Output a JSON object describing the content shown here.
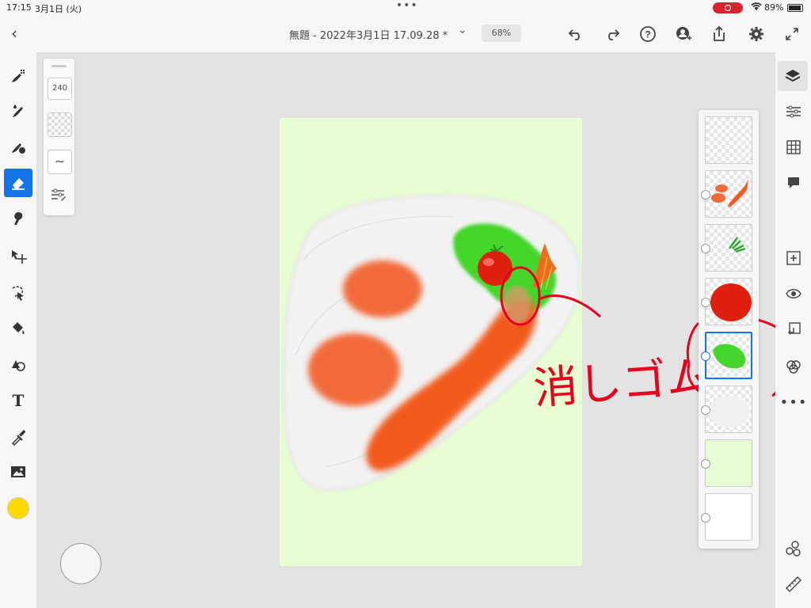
{
  "status_bar": {
    "time": "17:15",
    "date": "3月1日 (火)",
    "battery": "89%",
    "icons": [
      "screen-record-icon",
      "wifi-icon",
      "battery-icon"
    ]
  },
  "header": {
    "document_title": "無題 - 2022年3月1日 17.09.28 *",
    "zoom": "68%",
    "icons": [
      "back-icon",
      "undo-icon",
      "redo-icon",
      "help-icon",
      "invite-icon",
      "share-icon",
      "settings-icon",
      "fullscreen-icon"
    ]
  },
  "brush_panel": {
    "size": "240"
  },
  "left_tools": [
    "pixel-brush",
    "live-brush",
    "vector-brush",
    "eraser",
    "smudge",
    "transform",
    "selection",
    "fill",
    "shapes",
    "text",
    "eyedropper",
    "image"
  ],
  "active_tool": "eraser",
  "current_color": "#ffd800",
  "right_tools": [
    "layers",
    "layer-properties",
    "grid",
    "comments",
    "add-layer",
    "visibility",
    "merge",
    "blend",
    "more",
    "livestream",
    "ruler"
  ],
  "layers": [
    {
      "name": "empty",
      "selected": false
    },
    {
      "name": "shrimp",
      "selected": false
    },
    {
      "name": "herb",
      "selected": false
    },
    {
      "name": "tomato",
      "selected": false
    },
    {
      "name": "lettuce",
      "selected": true
    },
    {
      "name": "plate",
      "selected": false
    },
    {
      "name": "background-green",
      "selected": false
    },
    {
      "name": "white-paper",
      "selected": false
    }
  ],
  "annotation": {
    "text": "消しゴムで",
    "color": "#e8001c"
  }
}
